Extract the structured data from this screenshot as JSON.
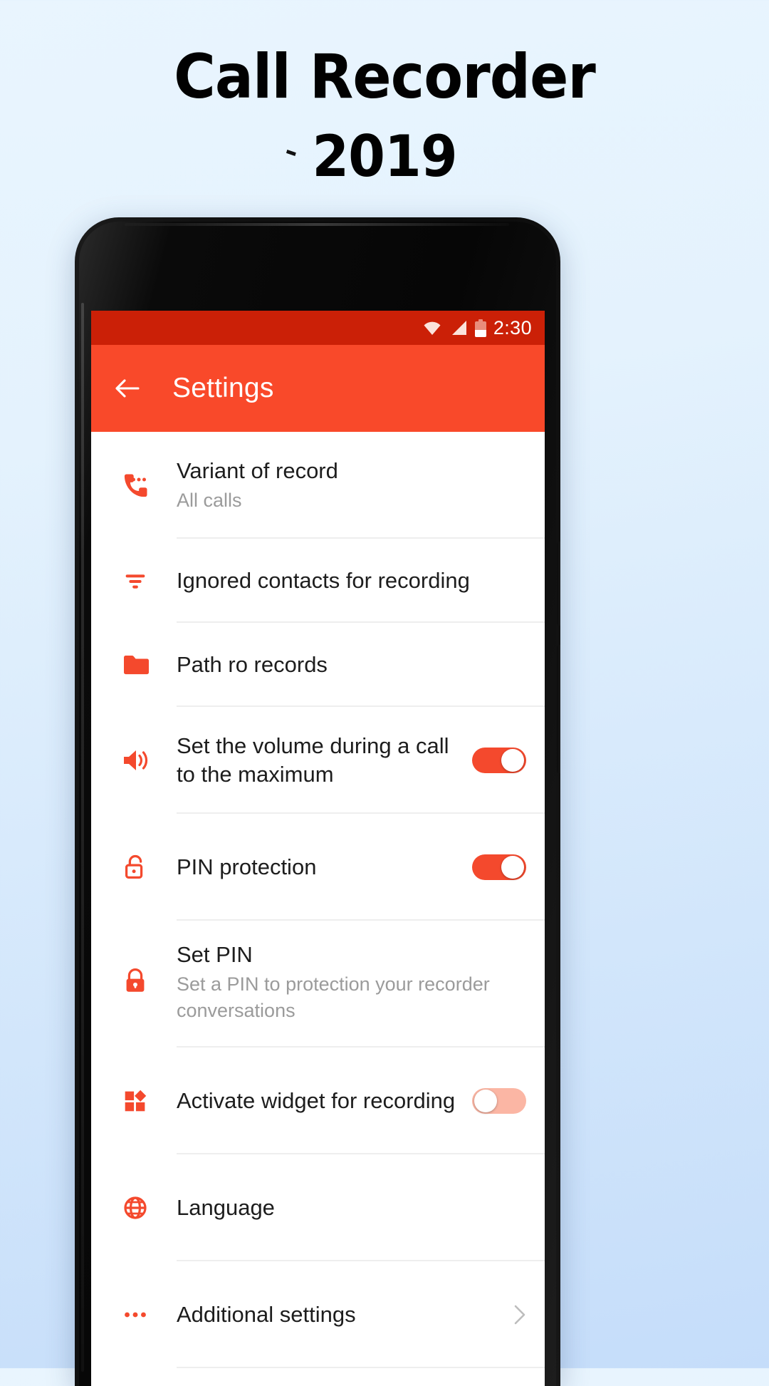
{
  "poster": {
    "title_line1": "Call Recorder",
    "title_line2": "2019"
  },
  "statusbar": {
    "time": "2:30",
    "wifi_icon": "wifi-icon",
    "signal_icon": "signal-icon",
    "battery_icon": "battery-icon"
  },
  "appbar": {
    "back_icon": "back-arrow-icon",
    "title": "Settings"
  },
  "settings": {
    "rows": [
      {
        "icon": "phone-dots-icon",
        "title": "Variant of record",
        "subtitle": "All calls",
        "control": "none"
      },
      {
        "icon": "filter-icon",
        "title": "Ignored contacts for recording",
        "subtitle": "",
        "control": "none"
      },
      {
        "icon": "folder-icon",
        "title": "Path ro records",
        "subtitle": "",
        "control": "none"
      },
      {
        "icon": "volume-icon",
        "title": "Set the volume during a call to the maximum",
        "subtitle": "",
        "control": "toggle-on"
      },
      {
        "icon": "lock-open-icon",
        "title": "PIN protection",
        "subtitle": "",
        "control": "toggle-on"
      },
      {
        "icon": "lock-closed-icon",
        "title": "Set PIN",
        "subtitle": "Set a PIN to protection your recorder conversations",
        "control": "none"
      },
      {
        "icon": "widget-icon",
        "title": "Activate widget for recording",
        "subtitle": "",
        "control": "toggle-off"
      },
      {
        "icon": "globe-icon",
        "title": "Language",
        "subtitle": "",
        "control": "none"
      },
      {
        "icon": "more-dots-icon",
        "title": "Additional settings",
        "subtitle": "",
        "control": "chevron"
      }
    ]
  },
  "colors": {
    "accent": "#f4492d",
    "appbar": "#f9492a",
    "statusbar": "#cb2007",
    "toggle_off_track": "#fbb6a4",
    "background_top": "#e9f5fe",
    "background_bottom": "#c5ddfa"
  }
}
